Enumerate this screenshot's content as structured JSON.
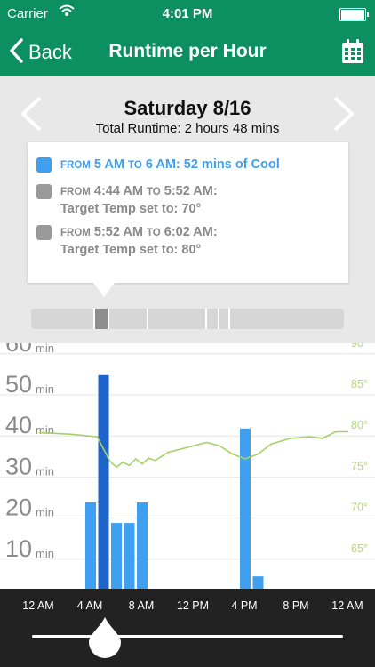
{
  "status": {
    "carrier": "Carrier",
    "time": "4:01 PM"
  },
  "nav": {
    "back_label": "Back",
    "title": "Runtime per Hour"
  },
  "day": {
    "title": "Saturday 8/16",
    "total_runtime": "Total Runtime: 2 hours 48 mins"
  },
  "popover": {
    "rows": [
      {
        "from": "FROM",
        "a": " 5 AM ",
        "to": "TO",
        "b": " 6 AM: 52 mins of Cool",
        "line2": ""
      },
      {
        "from": "FROM",
        "a": " 4:44 AM ",
        "to": "TO",
        "b": " 5:52 AM:",
        "line2": "Target Temp set to: 70°"
      },
      {
        "from": "FROM",
        "a": " 5:52 AM ",
        "to": "TO",
        "b": " 6:02 AM:",
        "line2": "Target Temp set to: 80°"
      }
    ]
  },
  "colors": {
    "brand": "#0c8f61",
    "cool": "#3fa0f2",
    "cool_selected": "#1f64c8",
    "temp_line": "#a6d26a"
  },
  "chart_data": {
    "type": "bar",
    "bar_unit": "min",
    "left_ticks": [
      {
        "value": 60,
        "label": "60",
        "unit": "min"
      },
      {
        "value": 50,
        "label": "50",
        "unit": "min"
      },
      {
        "value": 40,
        "label": "40",
        "unit": "min"
      },
      {
        "value": 30,
        "label": "30",
        "unit": "min"
      },
      {
        "value": 20,
        "label": "20",
        "unit": "min"
      },
      {
        "value": 10,
        "label": "10",
        "unit": "min"
      }
    ],
    "right_ticks": [
      "90°",
      "85°",
      "80°",
      "75°",
      "70°",
      "65°"
    ],
    "right_range": [
      65,
      90
    ],
    "ylim": [
      0,
      60
    ],
    "x_ticks": [
      "12 AM",
      "4 AM",
      "8 AM",
      "12 PM",
      "4 PM",
      "8 PM",
      "12 AM"
    ],
    "x_hours": [
      0,
      4,
      8,
      12,
      16,
      20,
      24
    ],
    "bars": [
      {
        "hour": 4,
        "value": 21
      },
      {
        "hour": 5,
        "value": 52,
        "selected": true
      },
      {
        "hour": 6,
        "value": 16
      },
      {
        "hour": 7,
        "value": 16
      },
      {
        "hour": 8,
        "value": 21
      },
      {
        "hour": 16,
        "value": 39
      },
      {
        "hour": 17,
        "value": 3
      }
    ],
    "temperature": [
      {
        "hour": 0,
        "temp": 79
      },
      {
        "hour": 2.5,
        "temp": 78.8
      },
      {
        "hour": 4.5,
        "temp": 78.5
      },
      {
        "hour": 5.5,
        "temp": 75.5
      },
      {
        "hour": 6,
        "temp": 74.8
      },
      {
        "hour": 6.5,
        "temp": 75.4
      },
      {
        "hour": 7,
        "temp": 75
      },
      {
        "hour": 7.5,
        "temp": 75.8
      },
      {
        "hour": 8,
        "temp": 75.2
      },
      {
        "hour": 8.5,
        "temp": 75.9
      },
      {
        "hour": 9,
        "temp": 75.6
      },
      {
        "hour": 10,
        "temp": 76.6
      },
      {
        "hour": 11.5,
        "temp": 77.2
      },
      {
        "hour": 13,
        "temp": 77.8
      },
      {
        "hour": 14,
        "temp": 77.4
      },
      {
        "hour": 15,
        "temp": 76.4
      },
      {
        "hour": 16,
        "temp": 75.8
      },
      {
        "hour": 17,
        "temp": 76.4
      },
      {
        "hour": 18,
        "temp": 77.6
      },
      {
        "hour": 19.5,
        "temp": 78.3
      },
      {
        "hour": 21,
        "temp": 78.5
      },
      {
        "hour": 22,
        "temp": 78.3
      },
      {
        "hour": 23,
        "temp": 79.1
      },
      {
        "hour": 27.5,
        "temp": 79.1
      }
    ]
  },
  "slider": {
    "value_hour": 5
  }
}
